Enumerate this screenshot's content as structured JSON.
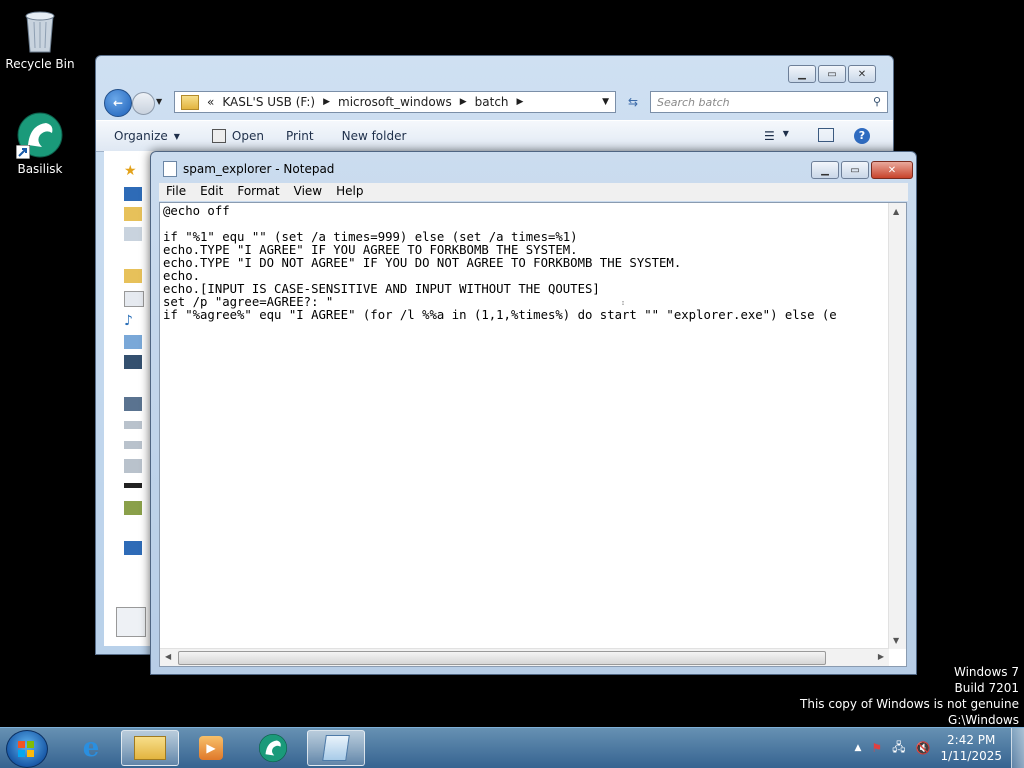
{
  "desktop": {
    "icons": [
      {
        "label": "Recycle Bin"
      },
      {
        "label": "Basilisk"
      }
    ]
  },
  "explorer": {
    "address_prefix": "«",
    "breadcrumb": [
      "KASL'S USB (F:)",
      "microsoft_windows",
      "batch"
    ],
    "search_placeholder": "Search batch",
    "toolbar": {
      "organize": "Organize",
      "open": "Open",
      "print": "Print",
      "new_folder": "New folder"
    }
  },
  "notepad": {
    "title": "spam_explorer - Notepad",
    "menu": [
      "File",
      "Edit",
      "Format",
      "View",
      "Help"
    ],
    "lines": [
      "@echo off",
      "",
      "if \"%1\" equ \"\" (set /a times=999) else (set /a times=%1)",
      "echo.TYPE \"I AGREE\" IF YOU AGREE TO FORKBOMB THE SYSTEM.",
      "echo.TYPE \"I DO NOT AGREE\" IF YOU DO NOT AGREE TO FORKBOMB THE SYSTEM.",
      "echo.",
      "echo.[INPUT IS CASE-SENSITIVE AND INPUT WITHOUT THE QOUTES]",
      "set /p \"agree=AGREE?: \"",
      "if \"%agree%\" equ \"I AGREE\" (for /l %%a in (1,1,%times%) do start \"\" \"explorer.exe\") else (e"
    ]
  },
  "watermark": {
    "line1": "Windows 7",
    "line2": "Build 7201",
    "line3": "This copy of Windows is not genuine",
    "line4": "G:\\Windows"
  },
  "taskbar": {
    "time": "2:42 PM",
    "date": "1/11/2025"
  }
}
